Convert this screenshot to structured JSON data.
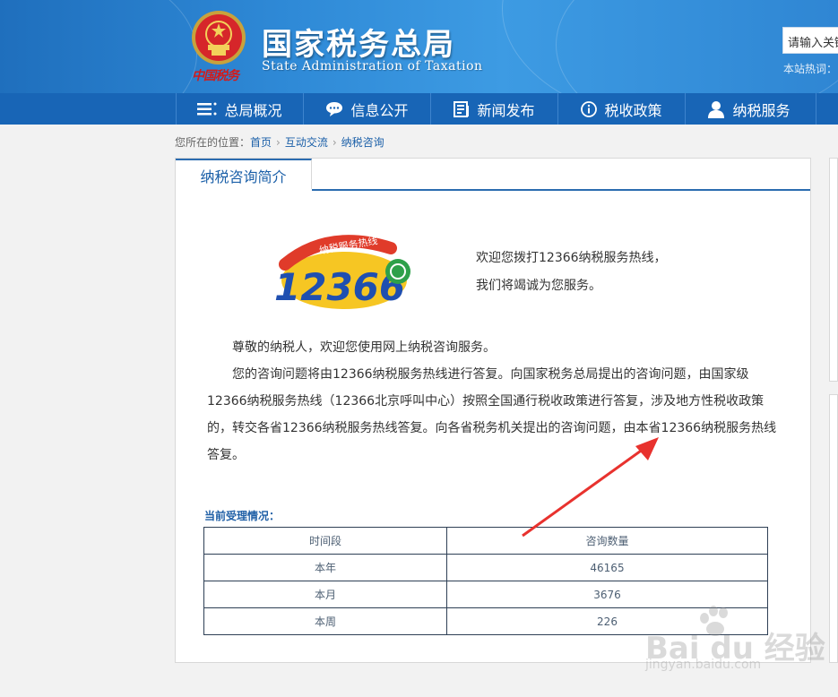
{
  "header": {
    "seal_text": "中国税务",
    "title_cn": "国家税务总局",
    "title_en": "State Administration of Taxation",
    "search_placeholder": "请输入关键",
    "hot_words_label": "本站热词："
  },
  "nav": {
    "items": [
      {
        "label": "总局概况",
        "icon": "list-icon"
      },
      {
        "label": "信息公开",
        "icon": "chat-bubble-icon"
      },
      {
        "label": "新闻发布",
        "icon": "newspaper-icon"
      },
      {
        "label": "税收政策",
        "icon": "info-icon"
      },
      {
        "label": "纳税服务",
        "icon": "user-icon"
      }
    ]
  },
  "breadcrumb": {
    "prefix": "您所在的位置：",
    "items": [
      "首页",
      "互动交流",
      "纳税咨询"
    ]
  },
  "panel": {
    "tab_label": "纳税咨询简介",
    "logo": {
      "banner_text": "纳税服务热线",
      "number": "12366"
    },
    "welcome_line1": "欢迎您拨打12366纳税服务热线，",
    "welcome_line2": "我们将竭诚为您服务。",
    "paragraph1": "尊敬的纳税人，欢迎您使用网上纳税咨询服务。",
    "paragraph2": "您的咨询问题将由12366纳税服务热线进行答复。向国家税务总局提出的咨询问题，由国家级12366纳税服务热线（12366北京呼叫中心）按照全国通行税收政策进行答复，涉及地方性税收政策的，转交各省12366纳税服务热线答复。向各省税务机关提出的咨询问题，由本省12366纳税服务热线答复。",
    "status_title": "当前受理情况：",
    "table": {
      "headers": [
        "时间段",
        "咨询数量"
      ],
      "rows": [
        [
          "本年",
          "46165"
        ],
        [
          "本月",
          "3676"
        ],
        [
          "本周",
          "226"
        ]
      ]
    }
  },
  "watermark": {
    "brand": "Bai du 经验",
    "url": "jingyan.baidu.com"
  },
  "colors": {
    "header_blue": "#2f8ad7",
    "nav_blue": "#1865b6",
    "link_blue": "#1a5fa8",
    "arrow_red": "#e8322e"
  }
}
